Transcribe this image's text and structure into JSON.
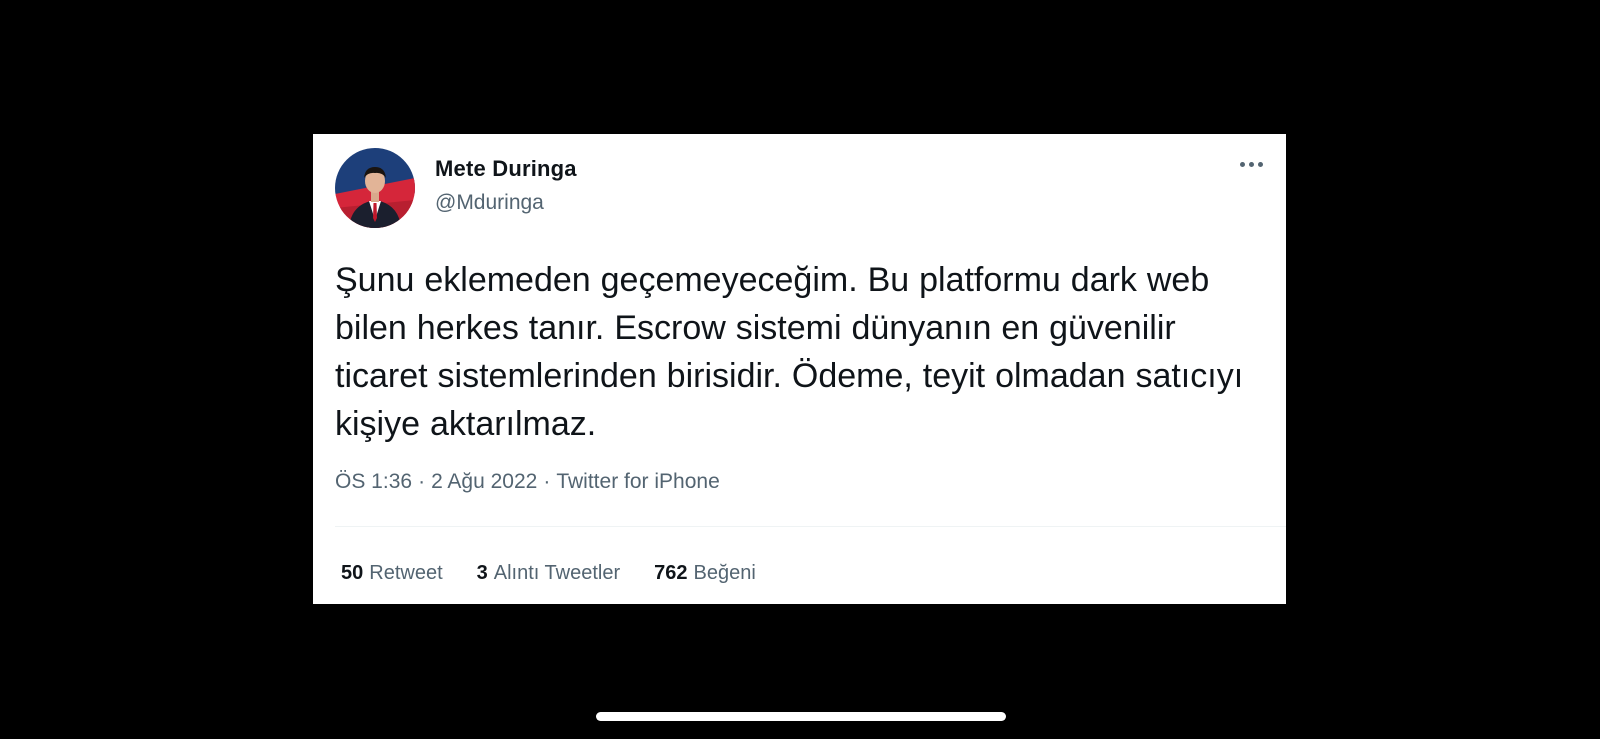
{
  "tweet": {
    "author": {
      "name": "Mete Duringa",
      "handle": "@Mduringa"
    },
    "text": "Şunu eklemeden geçemeyeceğim. Bu platformu dark web bilen herkes tanır. Escrow sistemi dünyanın en güvenilir ticaret sistemlerinden birisidir. Ödeme, teyit olmadan satıcıyı kişiye aktarılmaz.",
    "time": "ÖS 1:36",
    "separator": "·",
    "date": "2 Ağu 2022",
    "source": "Twitter for iPhone",
    "stats": {
      "retweets": {
        "count": "50",
        "label": "Retweet"
      },
      "quotes": {
        "count": "3",
        "label": "Alıntı Tweetler"
      },
      "likes": {
        "count": "762",
        "label": "Beğeni"
      }
    }
  },
  "icons": {
    "more": "more-horizontal-icon"
  },
  "colors": {
    "background": "#000000",
    "card": "#ffffff",
    "text_primary": "#0f1419",
    "text_secondary": "#536471"
  }
}
